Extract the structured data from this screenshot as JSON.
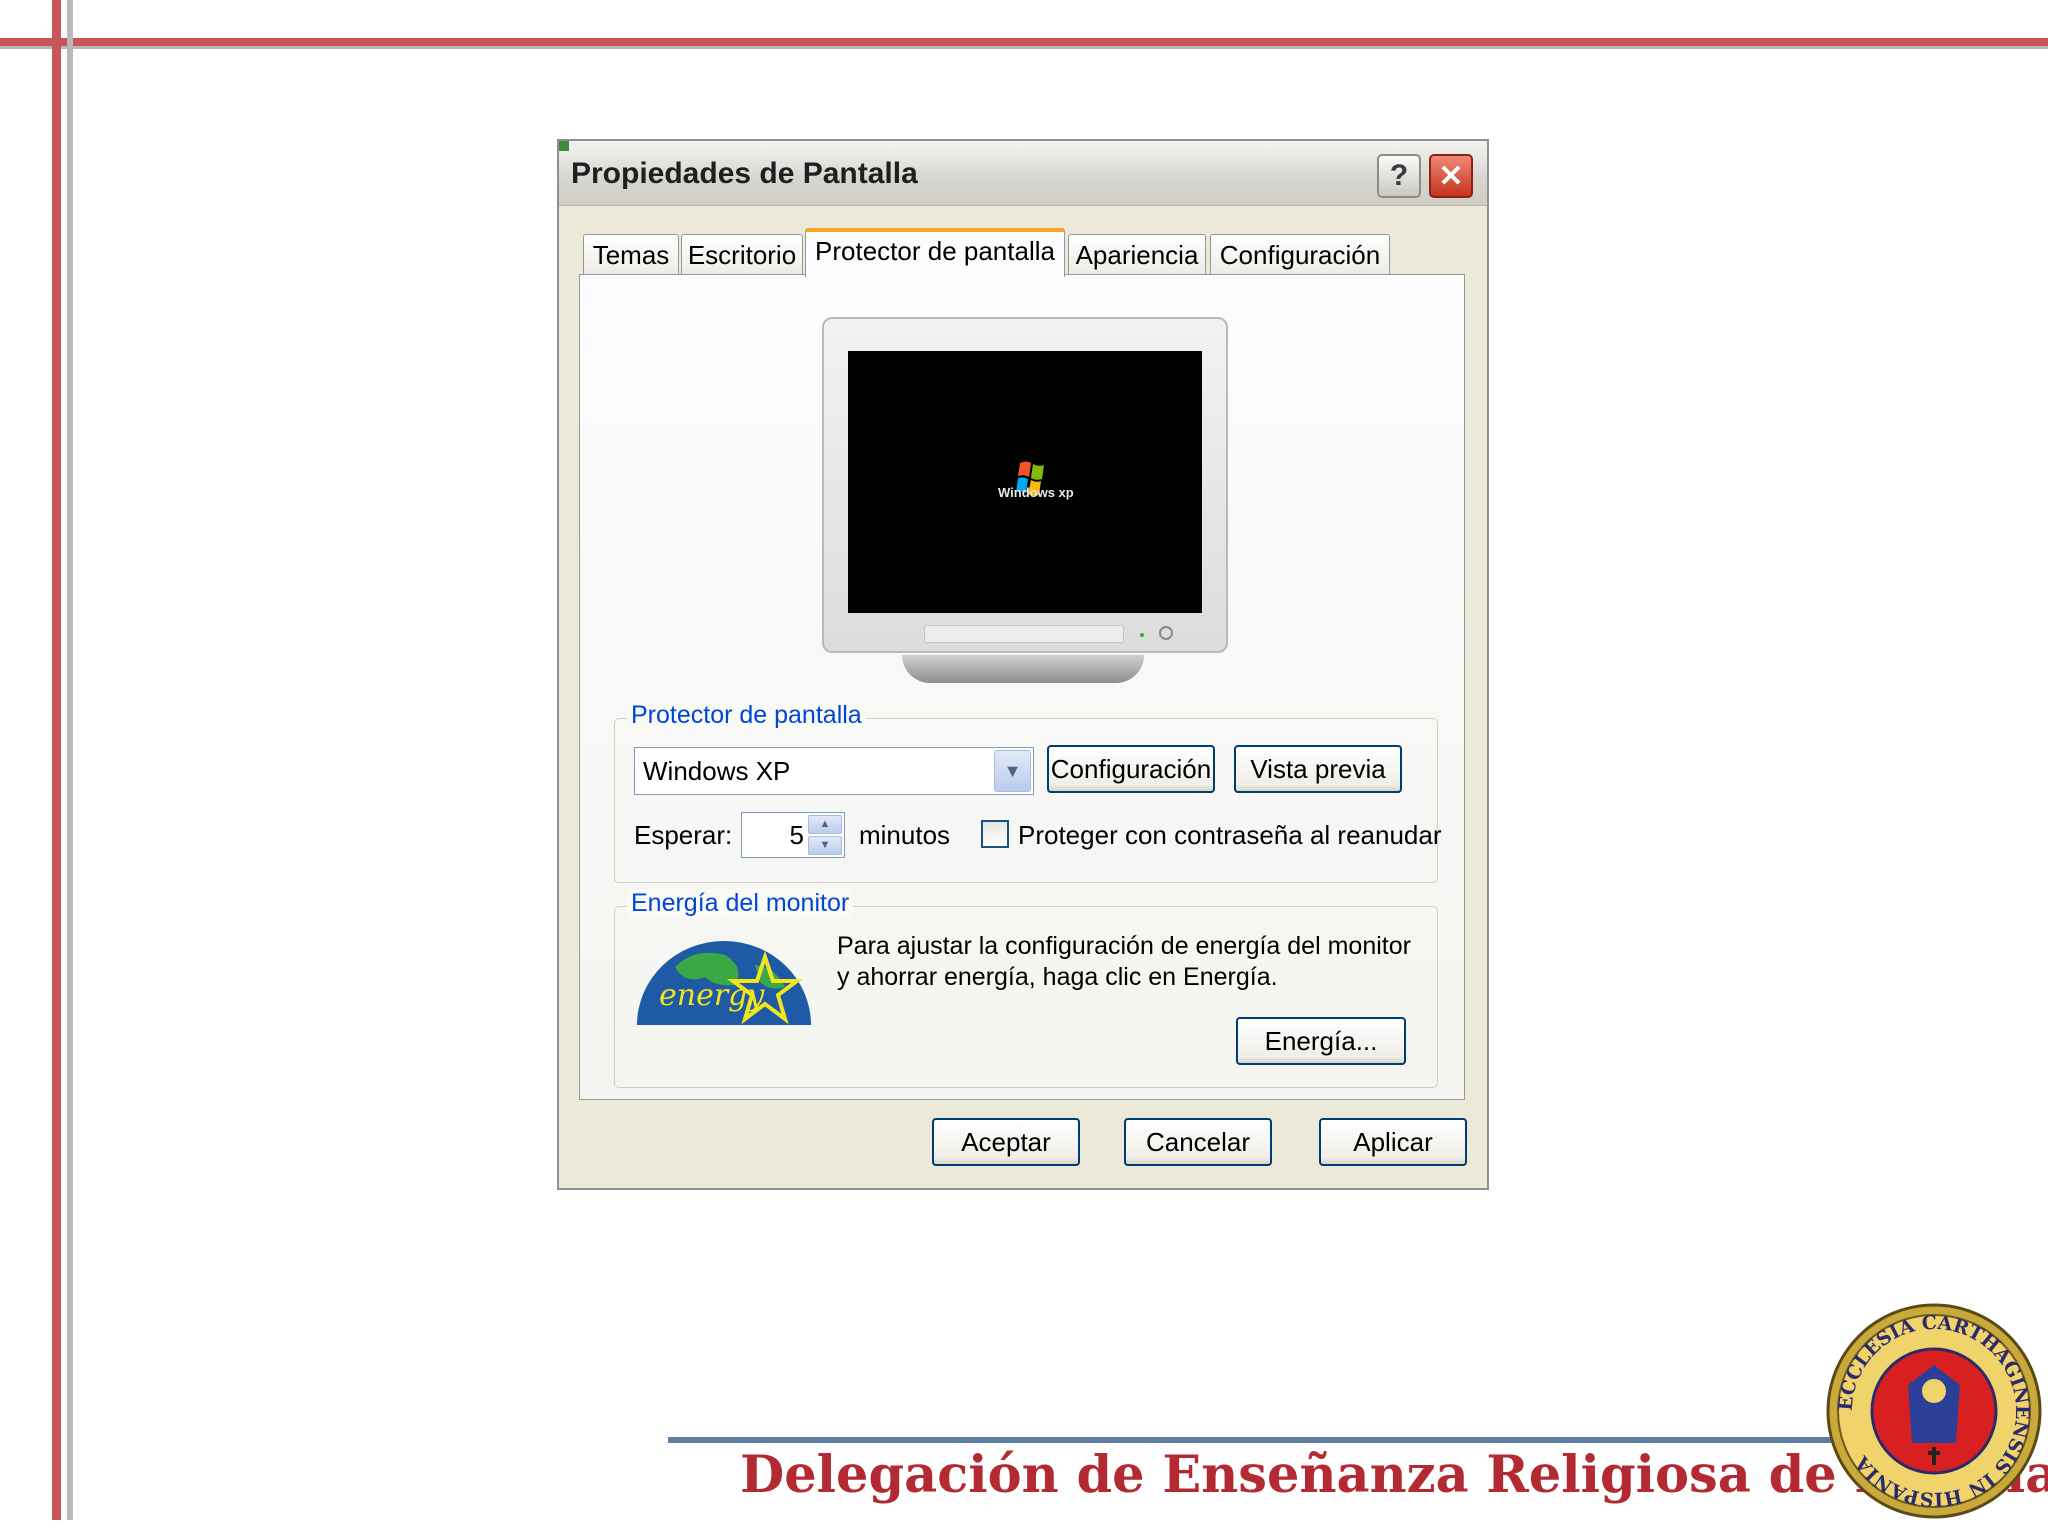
{
  "dialog": {
    "title": "Propiedades de Pantalla",
    "help_label": "?",
    "close_label": "✕",
    "tabs": [
      {
        "label": "Temas"
      },
      {
        "label": "Escritorio"
      },
      {
        "label": "Protector de pantalla"
      },
      {
        "label": "Apariencia"
      },
      {
        "label": "Configuración"
      }
    ],
    "active_tab": "Protector de pantalla"
  },
  "preview": {
    "logo_text": "Windows xp"
  },
  "screensaver": {
    "group_label": "Protector de pantalla",
    "selected": "Windows XP",
    "config_label": "Configuración",
    "preview_label": "Vista previa",
    "wait_label": "Esperar:",
    "wait_value": "5",
    "minutes_label": "minutos",
    "password_label": "Proteger con contraseña al reanudar",
    "password_checked": false
  },
  "energy": {
    "group_label": "Energía del monitor",
    "description": "Para ajustar la configuración de energía del monitor y ahorrar energía, haga clic en Energía.",
    "button_label": "Energía...",
    "logo_text": "energy"
  },
  "actions": {
    "ok_label": "Aceptar",
    "cancel_label": "Cancelar",
    "apply_label": "Aplicar"
  },
  "slide": {
    "footer_title": "Delegación de Enseñanza Religiosa de Murcia",
    "seal_text": "ECCLESIA CARTHAGINENSIS IN HISPANIA"
  },
  "colors": {
    "accent_red": "#c9555a",
    "footer_text": "#b32a33",
    "group_label": "#0046d5",
    "button_border": "#003c74",
    "tab_highlight": "#f5a623"
  }
}
